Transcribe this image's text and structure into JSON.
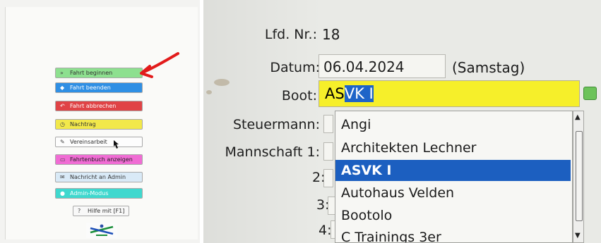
{
  "left_panel": {
    "buttons": [
      {
        "key": "fahrt_beginnen",
        "label": "Fahrt beginnen",
        "icon": "play-icon",
        "color": "#8de08f"
      },
      {
        "key": "fahrt_beenden",
        "label": "Fahrt beenden",
        "icon": "stop-icon",
        "color": "#2f8fe4"
      },
      {
        "key": "fahrt_abbrechen",
        "label": "Fahrt abbrechen",
        "icon": "undo-icon",
        "color": "#e04346"
      },
      {
        "key": "nachtrag",
        "label": "Nachtrag",
        "icon": "clock-icon",
        "color": "#f2e84a"
      },
      {
        "key": "vereinsarbeit",
        "label": "Vereinsarbeit",
        "icon": "wrench-icon",
        "color": "#fdfdfd"
      },
      {
        "key": "fahrtenbuch_anzeigen",
        "label": "Fahrtenbuch anzeigen",
        "icon": "book-icon",
        "color": "#f06cd4"
      },
      {
        "key": "nachricht_admin",
        "label": "Nachricht an Admin",
        "icon": "mail-icon",
        "color": "#d9eaf7"
      },
      {
        "key": "admin_modus",
        "label": "Admin-Modus",
        "icon": "admin-icon",
        "color": "#3fd8ce"
      },
      {
        "key": "hilfe",
        "label": "Hilfe mit [F1]",
        "icon": "help-icon",
        "color": "#f8f8f8"
      }
    ]
  },
  "right_panel": {
    "lfd_nr": {
      "label": "Lfd. Nr.:",
      "value": "18"
    },
    "datum": {
      "label": "Datum:",
      "value": "06.04.2024",
      "weekday": "(Samstag)"
    },
    "boot": {
      "label": "Boot:",
      "value_prefix": "AS",
      "value_selected": "VK I"
    },
    "steuermann": {
      "label": "Steuermann:"
    },
    "mannschaft": {
      "label": "Mannschaft 1:",
      "n2": "2:",
      "n3": "3:",
      "n4": "4:"
    },
    "dropdown_options": [
      {
        "label": "Angi",
        "selected": false
      },
      {
        "label": "Architekten Lechner",
        "selected": false
      },
      {
        "label": "ASVK I",
        "selected": true
      },
      {
        "label": "Autohaus Velden",
        "selected": false
      },
      {
        "label": "Bootolo",
        "selected": false
      },
      {
        "label": "C Trainings 3er",
        "selected": false
      }
    ]
  }
}
